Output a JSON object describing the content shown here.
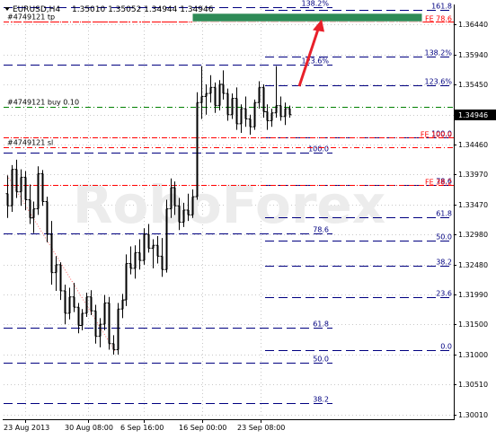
{
  "header": {
    "symbol_label": "EURUSD,H4",
    "ohlc": "1.35010 1.35052 1.34944 1.34946"
  },
  "colors": {
    "background": "#ffffff",
    "candle": "#000000",
    "grid": "#c8c8c8",
    "fib_line": "#000080",
    "fib_label": "#000080",
    "order_line": "#008000",
    "red_line": "#ff0000",
    "arrow": "#e8202a",
    "target_box_fill": "#2e8b57",
    "target_box_border": "#ffffff",
    "price_badge_bg": "#000000",
    "price_badge_text": "#ffffff",
    "watermark": "#e6e6e6"
  },
  "chart_data": {
    "type": "candlestick",
    "symbol": "EURUSD",
    "timeframe": "H4",
    "current_price": "1.34946",
    "ylim": [
      1.2995,
      1.3675
    ],
    "y_ticks": [
      "1.36440",
      "1.35940",
      "1.35450",
      "1.34946",
      "1.34460",
      "1.33970",
      "1.33470",
      "1.32980",
      "1.32480",
      "1.31990",
      "1.31500",
      "1.31000",
      "1.30510",
      "1.30010"
    ],
    "x_ticks": [
      "23 Aug 2013",
      "30 Aug 08:00",
      "6 Sep 16:00",
      "16 Sep 00:00",
      "23 Sep 08:00"
    ],
    "candles": [
      [
        1.3365,
        1.3395,
        1.3325,
        1.3345
      ],
      [
        1.3345,
        1.3412,
        1.3335,
        1.3405
      ],
      [
        1.3405,
        1.3421,
        1.3358,
        1.3368
      ],
      [
        1.3368,
        1.3405,
        1.3345,
        1.3392
      ],
      [
        1.3392,
        1.3402,
        1.3338,
        1.3355
      ],
      [
        1.3355,
        1.338,
        1.3315,
        1.3325
      ],
      [
        1.3325,
        1.3352,
        1.33,
        1.334
      ],
      [
        1.334,
        1.341,
        1.333,
        1.3398
      ],
      [
        1.3398,
        1.3404,
        1.3345,
        1.3352
      ],
      [
        1.3352,
        1.336,
        1.3285,
        1.3298
      ],
      [
        1.3298,
        1.332,
        1.3215,
        1.3235
      ],
      [
        1.3235,
        1.3262,
        1.3205,
        1.3248
      ],
      [
        1.3248,
        1.3252,
        1.319,
        1.3205
      ],
      [
        1.3205,
        1.3215,
        1.315,
        1.3168
      ],
      [
        1.3168,
        1.321,
        1.3158,
        1.3195
      ],
      [
        1.3195,
        1.3218,
        1.317,
        1.3178
      ],
      [
        1.3178,
        1.3185,
        1.3135,
        1.3148
      ],
      [
        1.3148,
        1.3175,
        1.314,
        1.3168
      ],
      [
        1.3168,
        1.3202,
        1.3162,
        1.3195
      ],
      [
        1.3195,
        1.3206,
        1.3165,
        1.3172
      ],
      [
        1.3172,
        1.3182,
        1.3118,
        1.313
      ],
      [
        1.313,
        1.316,
        1.3112,
        1.315
      ],
      [
        1.315,
        1.3198,
        1.314,
        1.3185
      ],
      [
        1.3185,
        1.3195,
        1.3108,
        1.3118
      ],
      [
        1.3118,
        1.3132,
        1.31,
        1.3108
      ],
      [
        1.3108,
        1.3185,
        1.31,
        1.3175
      ],
      [
        1.3175,
        1.32,
        1.316,
        1.319
      ],
      [
        1.319,
        1.3265,
        1.318,
        1.325
      ],
      [
        1.325,
        1.3278,
        1.3232,
        1.3242
      ],
      [
        1.3242,
        1.328,
        1.3225,
        1.3268
      ],
      [
        1.3268,
        1.329,
        1.324,
        1.3255
      ],
      [
        1.3255,
        1.3308,
        1.3248,
        1.3298
      ],
      [
        1.3298,
        1.3315,
        1.3268,
        1.3275
      ],
      [
        1.3275,
        1.329,
        1.3242,
        1.328
      ],
      [
        1.328,
        1.3295,
        1.325,
        1.3262
      ],
      [
        1.3262,
        1.3292,
        1.3228,
        1.324
      ],
      [
        1.324,
        1.3355,
        1.3235,
        1.334
      ],
      [
        1.334,
        1.339,
        1.3325,
        1.3375
      ],
      [
        1.3375,
        1.3385,
        1.333,
        1.3345
      ],
      [
        1.3345,
        1.3358,
        1.3305,
        1.3318
      ],
      [
        1.3318,
        1.335,
        1.331,
        1.3338
      ],
      [
        1.3338,
        1.3365,
        1.332,
        1.333
      ],
      [
        1.333,
        1.3372,
        1.3325,
        1.336
      ],
      [
        1.336,
        1.3532,
        1.3355,
        1.3515
      ],
      [
        1.3515,
        1.3575,
        1.3488,
        1.3525
      ],
      [
        1.3525,
        1.3545,
        1.3495,
        1.353
      ],
      [
        1.353,
        1.356,
        1.3515,
        1.354
      ],
      [
        1.354,
        1.3548,
        1.3498,
        1.351
      ],
      [
        1.351,
        1.3552,
        1.3502,
        1.3545
      ],
      [
        1.3545,
        1.3568,
        1.352,
        1.353
      ],
      [
        1.353,
        1.3538,
        1.3485,
        1.3495
      ],
      [
        1.3495,
        1.353,
        1.3488,
        1.3522
      ],
      [
        1.3522,
        1.354,
        1.347,
        1.348
      ],
      [
        1.348,
        1.3512,
        1.3465,
        1.3505
      ],
      [
        1.3505,
        1.3525,
        1.3475,
        1.3488
      ],
      [
        1.3488,
        1.3495,
        1.3462,
        1.3475
      ],
      [
        1.3475,
        1.352,
        1.347,
        1.3515
      ],
      [
        1.3515,
        1.355,
        1.3505,
        1.354
      ],
      [
        1.354,
        1.3545,
        1.349,
        1.35
      ],
      [
        1.35,
        1.3512,
        1.347,
        1.3485
      ],
      [
        1.3485,
        1.3505,
        1.3475,
        1.3498
      ],
      [
        1.3498,
        1.3575,
        1.349,
        1.351
      ],
      [
        1.351,
        1.3525,
        1.3485,
        1.3492
      ],
      [
        1.3492,
        1.3515,
        1.3478,
        1.3505
      ],
      [
        1.3505,
        1.351,
        1.349,
        1.3495
      ]
    ],
    "fib_levels_right": [
      {
        "label": "161.8",
        "price": 1.3668
      },
      {
        "label": "138.2%",
        "price": 1.359
      },
      {
        "label": "123.6%",
        "price": 1.3543
      },
      {
        "label": "100.0",
        "price": 1.3458
      },
      {
        "label": "78.6",
        "price": 1.338
      },
      {
        "label": "61.8",
        "price": 1.3326
      },
      {
        "label": "50.0",
        "price": 1.3288
      },
      {
        "label": "38.2",
        "price": 1.3247
      },
      {
        "label": "23.6",
        "price": 1.3194
      },
      {
        "label": "0.0",
        "price": 1.3107
      }
    ],
    "fib_levels_mid": [
      {
        "label": "138.2%",
        "price": 1.3672
      },
      {
        "label": "123.6%",
        "price": 1.3578
      },
      {
        "label": "100.0",
        "price": 1.3433
      },
      {
        "label": "78.6",
        "price": 1.33
      },
      {
        "label": "61.8",
        "price": 1.3145
      },
      {
        "label": "50.0",
        "price": 1.3087
      },
      {
        "label": "38.2",
        "price": 1.302
      }
    ],
    "fe_levels": [
      {
        "label": "FE 78.6",
        "price": 1.3648
      },
      {
        "label": "FE 100.0",
        "price": 1.3458
      },
      {
        "label": "FE 38.2",
        "price": 1.338
      }
    ],
    "order_lines": [
      {
        "label": "#4749121 tp",
        "price": 1.3648,
        "kind": "red"
      },
      {
        "label": "#4749121 buy 0.10",
        "price": 1.3508,
        "kind": "green"
      },
      {
        "label": "#4749121 sl",
        "price": 1.3442,
        "kind": "red"
      }
    ],
    "target_zone": {
      "price_top": 1.3662,
      "price_bottom": 1.3648
    },
    "arrow": {
      "from_price": 1.353,
      "to_price": 1.3652
    },
    "watermark": "RoboForex"
  }
}
